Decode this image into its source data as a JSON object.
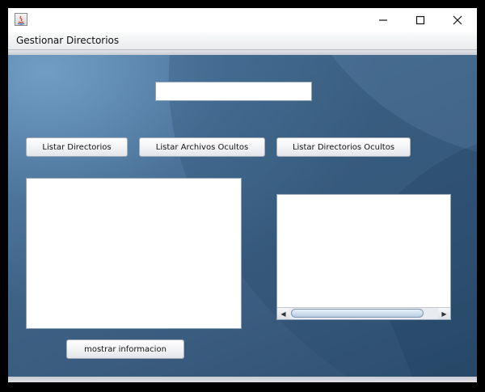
{
  "window": {
    "title": "",
    "controls": {
      "minimize_icon": "minimize-icon",
      "maximize_icon": "maximize-icon",
      "close_icon": "close-icon"
    }
  },
  "menubar": {
    "items": [
      {
        "label": "Gestionar Directorios"
      }
    ]
  },
  "form": {
    "path_input": {
      "value": "",
      "placeholder": ""
    },
    "buttons": {
      "list_dirs": "Listar Directorios",
      "list_hidden_files": "Listar Archivos Ocultos",
      "list_hidden_dirs": "Listar Directorios Ocultos",
      "show_info": "mostrar informacion"
    },
    "left_list": {
      "items": []
    },
    "right_list": {
      "items": []
    }
  },
  "colors": {
    "desktop_bg": "#3f6387",
    "button_border": "#a7adb6",
    "scroll_thumb": "#b9cde2"
  }
}
